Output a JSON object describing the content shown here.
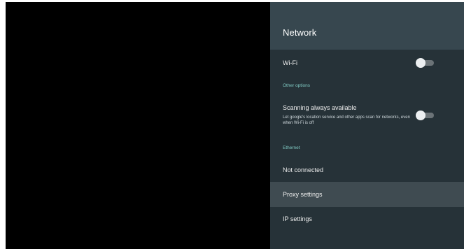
{
  "panel": {
    "title": "Network",
    "wifi": {
      "label": "Wi-Fi",
      "enabled": false
    },
    "other_options_header": "Other options",
    "scanning": {
      "label": "Scanning always available",
      "description": "Let google's location service and other apps scan for networks, even when Wi-Fi is off",
      "enabled": false
    },
    "ethernet_header": "Ethernet",
    "ethernet_status": "Not connected",
    "proxy_settings": "Proxy settings",
    "ip_settings": "IP settings"
  },
  "colors": {
    "panel_background": "#263238",
    "header_background": "#37474f",
    "section_label": "#80cbc4",
    "highlight_row": "#3f4b51"
  }
}
